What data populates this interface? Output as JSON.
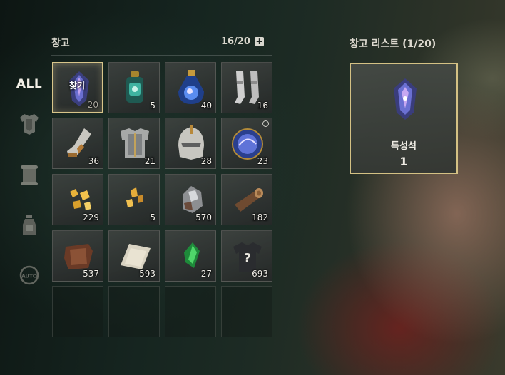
{
  "rail": {
    "all_label": "ALL",
    "categories": [
      {
        "icon": "armor-icon"
      },
      {
        "icon": "scroll-icon"
      },
      {
        "icon": "potion-icon"
      },
      {
        "icon": "auto-icon",
        "label": "AUTO"
      }
    ]
  },
  "storage": {
    "title": "창고",
    "count": "16/20",
    "add_label": "+",
    "find_label": "찾기",
    "slots": [
      {
        "icon": "trait-stone-icon",
        "qty": "20",
        "selected": true
      },
      {
        "icon": "green-potion-icon",
        "qty": "5"
      },
      {
        "icon": "blue-potion-icon",
        "qty": "40"
      },
      {
        "icon": "greaves-icon",
        "qty": "16"
      },
      {
        "icon": "gauntlet-icon",
        "qty": "36"
      },
      {
        "icon": "chest-armor-icon",
        "qty": "21"
      },
      {
        "icon": "helmet-icon",
        "qty": "28"
      },
      {
        "icon": "magic-orb-icon",
        "qty": "23",
        "timed": true
      },
      {
        "icon": "gold-ore-icon",
        "qty": "229"
      },
      {
        "icon": "gold-shards-icon",
        "qty": "5"
      },
      {
        "icon": "iron-ore-icon",
        "qty": "570"
      },
      {
        "icon": "wood-log-icon",
        "qty": "182"
      },
      {
        "icon": "leather-icon",
        "qty": "537"
      },
      {
        "icon": "cloth-icon",
        "qty": "593"
      },
      {
        "icon": "emerald-icon",
        "qty": "27"
      },
      {
        "icon": "mystery-armor-icon",
        "qty": "693"
      },
      {
        "icon": "empty-slot",
        "qty": ""
      },
      {
        "icon": "empty-slot",
        "qty": ""
      },
      {
        "icon": "empty-slot",
        "qty": ""
      },
      {
        "icon": "empty-slot",
        "qty": ""
      }
    ]
  },
  "storage_list": {
    "title": "창고 리스트 (1/20)",
    "item": {
      "icon": "trait-stone-icon",
      "name": "특성석",
      "qty": "1"
    }
  },
  "colors": {
    "accent_gold": "#d4c184",
    "panel_dark": "#1d2b24"
  }
}
